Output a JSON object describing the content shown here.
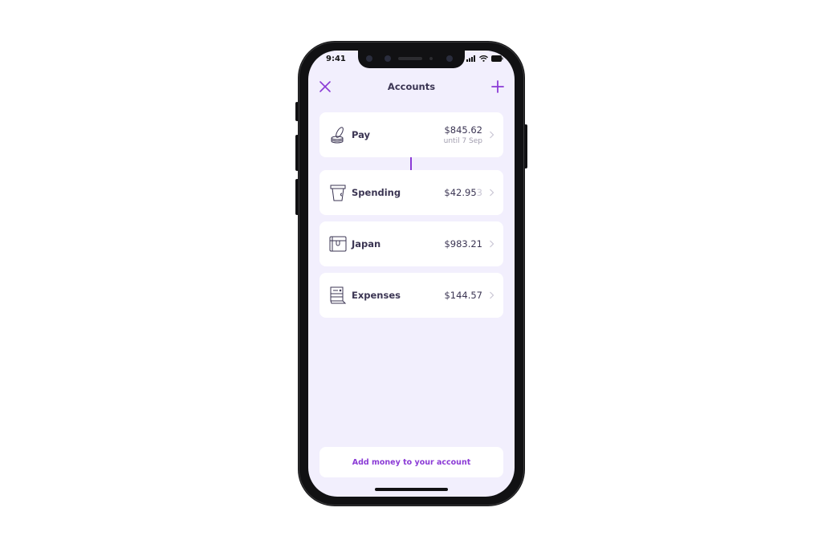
{
  "status_bar": {
    "time": "9:41",
    "icons": [
      "signal-icon",
      "wifi-icon",
      "battery-icon"
    ]
  },
  "nav": {
    "title": "Accounts",
    "left_icon": "close-icon",
    "right_icon": "plus-icon"
  },
  "accounts": [
    {
      "name": "Pay",
      "icon": "coins-icon",
      "amount": "$845.62",
      "amount_ghost": "",
      "subtitle": "until 7 Sep"
    },
    {
      "name": "Spending",
      "icon": "cup-icon",
      "amount": "$42.95",
      "amount_ghost": "3",
      "subtitle": ""
    },
    {
      "name": "Japan",
      "icon": "chest-icon",
      "amount": "$983.21",
      "amount_ghost": "",
      "subtitle": ""
    },
    {
      "name": "Expenses",
      "icon": "receipt-icon",
      "amount": "$144.57",
      "amount_ghost": "",
      "subtitle": ""
    }
  ],
  "footer": {
    "add_money_label": "Add money to your account"
  },
  "colors": {
    "accent": "#8b3bd6",
    "background": "#f2effd",
    "text": "#3b3553",
    "muted": "#a09cae"
  }
}
